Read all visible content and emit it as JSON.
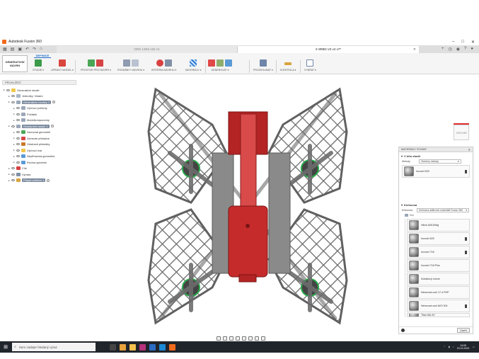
{
  "window": {
    "app_title": "Autodesk Fusion 360"
  },
  "tabs": [
    {
      "label": "DRN 13E5 v53 v2",
      "active": false
    },
    {
      "label": "X 9R8N V3 v4 v7*",
      "active": true
    }
  ],
  "ribbon": {
    "workspace": "GENERATIVNÍ NÁVRH",
    "active_tab": "DEFINICE",
    "groups": [
      {
        "label": "STUDIE ▾"
      },
      {
        "label": "UPRAVIT MODEL ▾"
      },
      {
        "label": "PROSTOR PRO NÁVRH ▾"
      },
      {
        "label": "PODMÍNKY NÁVRHU ▾"
      },
      {
        "label": "KRITÉRIA NÁVRHU ▾"
      },
      {
        "label": "MATERIÁLY ▾"
      },
      {
        "label": "GENEROVAT ▾"
      },
      {
        "label": "PROZKOUMAT ▾"
      },
      {
        "label": "KONTROLA ▾"
      },
      {
        "label": "VYBRAT ▾"
      }
    ]
  },
  "browser": {
    "header": "PROHLÍŽEČ",
    "tree": [
      {
        "label": "Generativní studie",
        "level": 0,
        "hl": false
      },
      {
        "label": "Jednotky: Vlastní",
        "level": 1,
        "hl": false
      },
      {
        "label": "Generativní modely 1",
        "level": 1,
        "hl": true
      },
      {
        "label": "Výchozí pohledy",
        "level": 2,
        "hl": false
      },
      {
        "label": "Počátek",
        "level": 2,
        "hl": false
      },
      {
        "label": "Modelkomponenty",
        "level": 2,
        "hl": false
      },
      {
        "label": "Strukturální studie 1",
        "level": 1,
        "hl": true
      },
      {
        "label": "Zachovat geometrii",
        "level": 2,
        "hl": false
      },
      {
        "label": "Zamezte překážce",
        "level": 2,
        "hl": false
      },
      {
        "label": "Odstranit překážky",
        "level": 2,
        "hl": false
      },
      {
        "label": "Výchozí tvar",
        "level": 2,
        "hl": false
      },
      {
        "label": "Nepřiřazená geometrie",
        "level": 2,
        "hl": false
      },
      {
        "label": "Rovina symetrie",
        "level": 2,
        "hl": false
      },
      {
        "label": "Cíle",
        "level": 1,
        "hl": false
      },
      {
        "label": "Výroba",
        "level": 1,
        "hl": false
      },
      {
        "label": "Případ zatížení 1",
        "level": 1,
        "hl": true
      }
    ]
  },
  "viewcube": {
    "label": "VRCHNÍ"
  },
  "materials": {
    "title": "MATERIÁLY STUDIE",
    "in_study": {
      "header": "V této studii",
      "filter_label": "Metody",
      "filter_value": "Všechny metody",
      "items": [
        "Inconel 625"
      ]
    },
    "library": {
      "header": "Knihovna",
      "source_label": "Knihovna",
      "source_value": "Knihovna aditivních materiálů Fusion 360",
      "folder": "Kov",
      "items": [
        "Hliník AlSi10Mg",
        "Inconel 625",
        "Inconel 718",
        "Inconel 718 Plus",
        "Kobaltový chrom",
        "Nerezová ocel 17-4 PHP",
        "Nerezová ocel AISI 304",
        "Titan 6Al-4V"
      ]
    },
    "close_label": "Zavřít"
  },
  "taskbar": {
    "search_placeholder": "Sem zadejte hledaný výraz",
    "time": "14:00",
    "date": "15.10.2021"
  },
  "colors": {
    "accent": "#1b6ac9",
    "part_red": "#c62b2b",
    "frame_dark": "#6a6a6a",
    "taskbar": "#20242b"
  }
}
